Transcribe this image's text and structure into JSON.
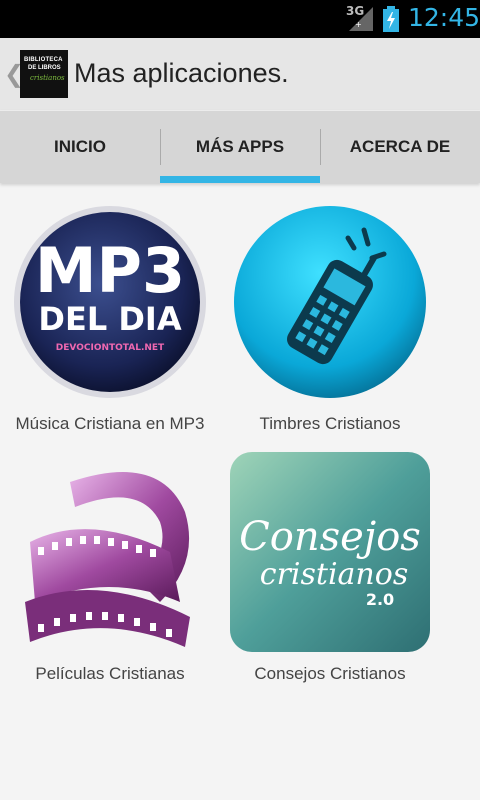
{
  "status_bar": {
    "network": "3G",
    "time": "12:45"
  },
  "action_bar": {
    "up_icon": "chevron-left-icon",
    "app_icon_lines": [
      "BIBLIOTECA",
      "DE LIBROS",
      "cristianos"
    ],
    "title": "Mas aplicaciones."
  },
  "tabs": [
    {
      "label": "INICIO",
      "selected": false
    },
    {
      "label": "MÁS APPS",
      "selected": true
    },
    {
      "label": "ACERCA DE",
      "selected": false
    }
  ],
  "apps": [
    {
      "name": "Música Cristiana en MP3",
      "icon_lines": [
        "MP3",
        "DEL DIA",
        "DEVOCIONTOTAL.NET"
      ]
    },
    {
      "name": "Timbres Cristianos"
    },
    {
      "name": "Películas Cristianas"
    },
    {
      "name": "Consejos Cristianos",
      "icon_lines": [
        "Consejos",
        "cristianos",
        "2.0"
      ]
    }
  ],
  "colors": {
    "accent": "#33b5e5",
    "status_bar": "#000000",
    "action_bar": "#e6e6e6",
    "tab_bar": "#d6d6d6"
  }
}
